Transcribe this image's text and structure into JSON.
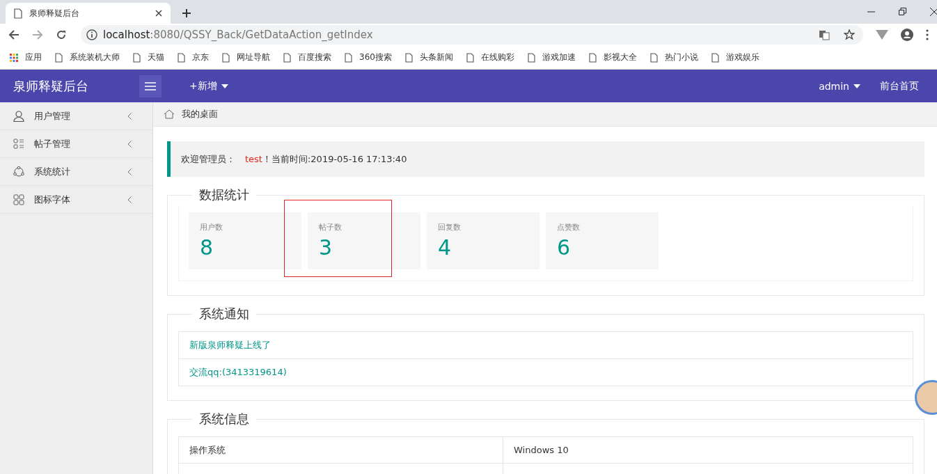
{
  "browser": {
    "tab_title": "泉师释疑后台",
    "url_host": "localhost",
    "url_rest": ":8080/QSSY_Back/GetDataAction_getIndex",
    "apps_label": "应用",
    "bookmarks": [
      "系统装机大师",
      "天猫",
      "京东",
      "网址导航",
      "百度搜索",
      "360搜索",
      "头条新闻",
      "在线购彩",
      "游戏加速",
      "影视大全",
      "热门小说",
      "游戏娱乐"
    ]
  },
  "header": {
    "title": "泉师释疑后台",
    "add_label": "+新增",
    "user": "admin",
    "home_link": "前台首页"
  },
  "sidebar": {
    "items": [
      {
        "label": "用户管理"
      },
      {
        "label": "帖子管理"
      },
      {
        "label": "系统统计"
      },
      {
        "label": "图标字体"
      }
    ]
  },
  "breadcrumb": "我的桌面",
  "welcome": {
    "prefix": "欢迎管理员：",
    "name": "test",
    "suffix": "！当前时间:2019-05-16 17:13:40"
  },
  "stats": {
    "title": "数据统计",
    "cards": [
      {
        "label": "用户数",
        "value": "8",
        "highlighted": false
      },
      {
        "label": "帖子数",
        "value": "3",
        "highlighted": true
      },
      {
        "label": "回复数",
        "value": "4",
        "highlighted": false
      },
      {
        "label": "点赞数",
        "value": "6",
        "highlighted": false
      }
    ]
  },
  "notices": {
    "title": "系统通知",
    "items": [
      "新版泉师释疑上线了",
      "交流qq:(3413319614)"
    ]
  },
  "sysinfo": {
    "title": "系统信息",
    "rows": [
      {
        "name": "操作系统",
        "value": "Windows 10"
      }
    ]
  }
}
